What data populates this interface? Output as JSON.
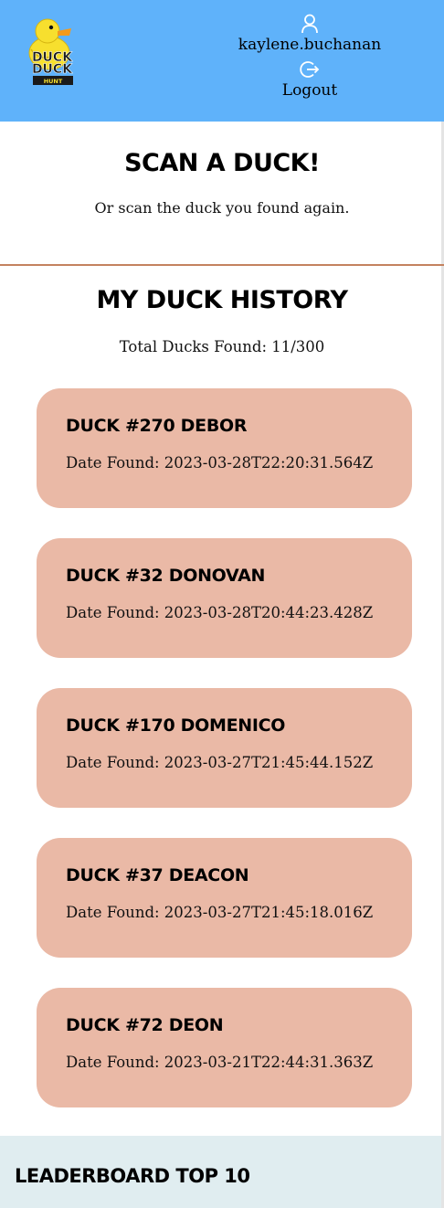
{
  "header": {
    "logo": {
      "line1": "DUCK",
      "line2": "DUCK",
      "line3": "HUNT"
    },
    "username": "kaylene.buchanan",
    "logout_label": "Logout"
  },
  "scan": {
    "title": "Scan a Duck!",
    "subtitle": "Or scan the duck you found again."
  },
  "history": {
    "title": "My Duck History",
    "total": "Total Ducks Found: 11/300",
    "cards": [
      {
        "title": "Duck #270 Debor",
        "date": "Date Found: 2023-03-28T22:20:31.564Z"
      },
      {
        "title": "Duck #32 Donovan",
        "date": "Date Found: 2023-03-28T20:44:23.428Z"
      },
      {
        "title": "Duck #170 Domenico",
        "date": "Date Found: 2023-03-27T21:45:44.152Z"
      },
      {
        "title": "Duck #37 Deacon",
        "date": "Date Found: 2023-03-27T21:45:18.016Z"
      },
      {
        "title": "Duck #72 Deon",
        "date": "Date Found: 2023-03-21T22:44:31.363Z"
      }
    ]
  },
  "leaderboard": {
    "title": "Leaderboard Top 10"
  },
  "colors": {
    "header_bg": "#5fb2fa",
    "card_bg": "#eab9a6",
    "divider": "#c4825f",
    "leaderboard_bg": "#e0edf0",
    "duck_yellow": "#f7df2e"
  },
  "icons": [
    "duck-logo",
    "user-icon",
    "logout-icon"
  ]
}
